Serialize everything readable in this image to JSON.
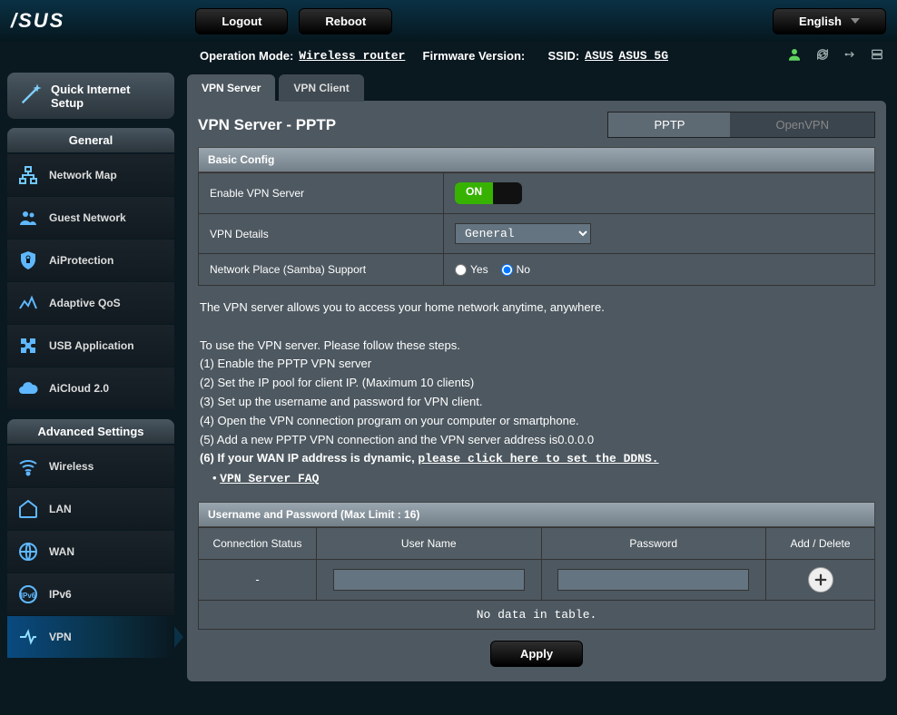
{
  "brand": "/SUS",
  "top": {
    "logout": "Logout",
    "reboot": "Reboot",
    "language": "English"
  },
  "status": {
    "op_mode_label": "Operation Mode:",
    "op_mode_value": "Wireless router",
    "fw_label": "Firmware Version:",
    "fw_value": "",
    "ssid_label": "SSID:",
    "ssid1": "ASUS",
    "ssid2": "ASUS_5G"
  },
  "sidebar": {
    "quick_setup": "Quick Internet Setup",
    "general_header": "General",
    "general_items": [
      "Network Map",
      "Guest Network",
      "AiProtection",
      "Adaptive QoS",
      "USB Application",
      "AiCloud 2.0"
    ],
    "advanced_header": "Advanced Settings",
    "advanced_items": [
      "Wireless",
      "LAN",
      "WAN",
      "IPv6",
      "VPN"
    ]
  },
  "tabs": {
    "server": "VPN Server",
    "client": "VPN Client"
  },
  "page": {
    "title": "VPN Server - PPTP",
    "subtabs": {
      "pptp": "PPTP",
      "openvpn": "OpenVPN"
    },
    "basic_config_header": "Basic Config",
    "rows": {
      "enable_label": "Enable VPN Server",
      "toggle_on": "ON",
      "details_label": "VPN Details",
      "details_value": "General",
      "samba_label": "Network Place (Samba) Support",
      "yes": "Yes",
      "no": "No"
    },
    "desc": {
      "line0": "The VPN server allows you to access your home network anytime, anywhere.",
      "line1": "To use the VPN server. Please follow these steps.",
      "s1": "(1) Enable the PPTP VPN server",
      "s2": "(2) Set the IP pool for client IP. (Maximum 10 clients)",
      "s3": "(3) Set up the username and password for VPN client.",
      "s4": "(4) Open the VPN connection program on your computer or smartphone.",
      "s5": "(5) Add a new PPTP VPN connection and the VPN server address is0.0.0.0",
      "s6_prefix": "(6) If your WAN IP address is dynamic, ",
      "s6_link": "please click here to set the DDNS.",
      "faq": "VPN Server FAQ"
    },
    "user_section_header": "Username and Password (Max Limit : 16)",
    "user_table": {
      "h_conn": "Connection Status",
      "h_user": "User Name",
      "h_pass": "Password",
      "h_add": "Add / Delete",
      "conn_placeholder": "-",
      "no_data": "No data in table."
    },
    "apply": "Apply"
  }
}
